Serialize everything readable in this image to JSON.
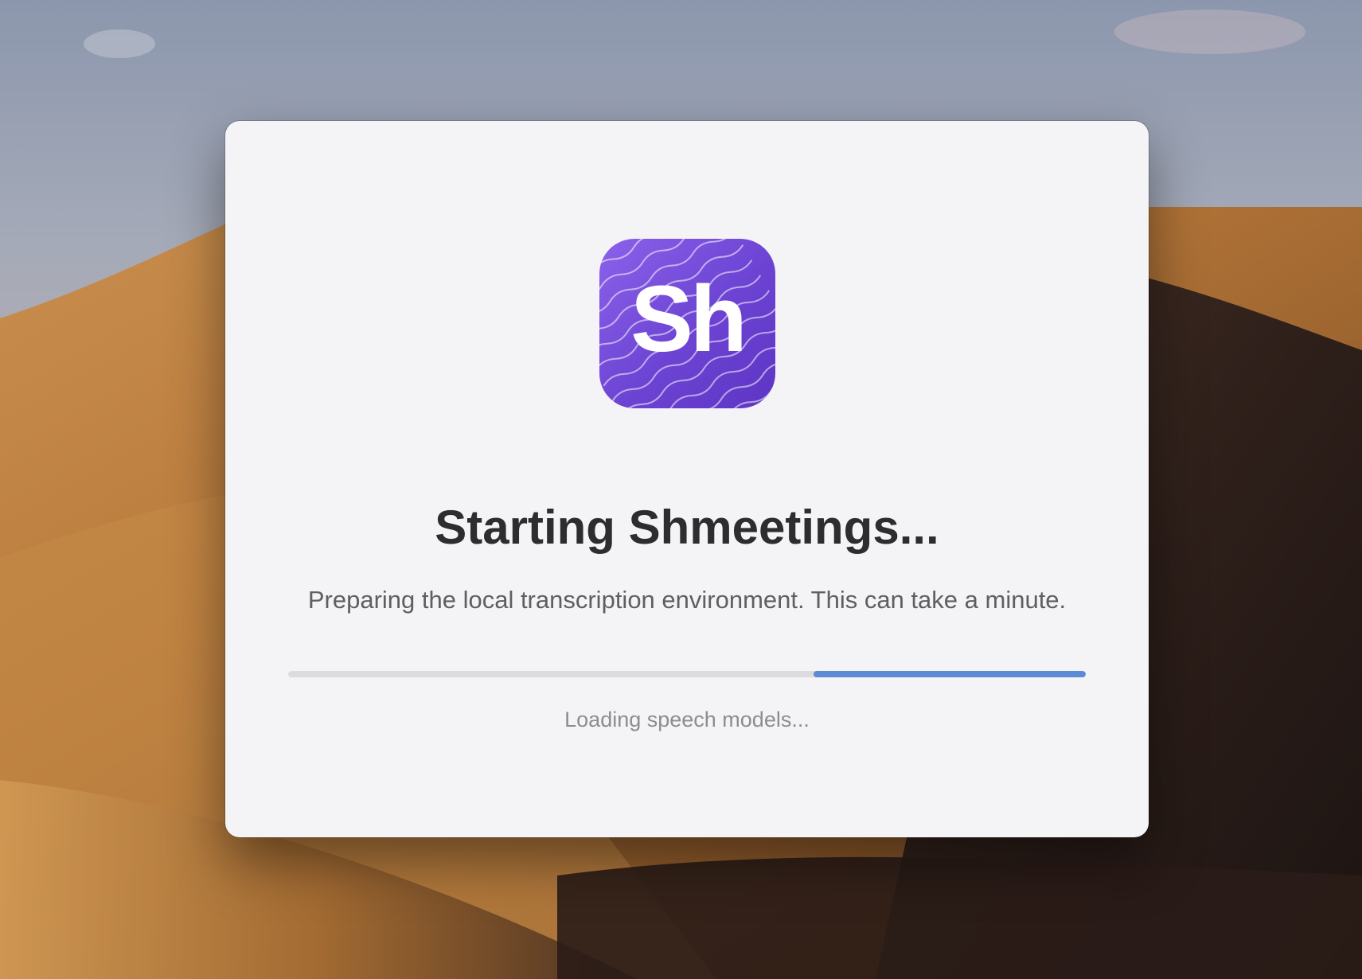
{
  "app": {
    "name": "Shmeetings",
    "icon_name": "shmeetings-app-icon",
    "monogram": "Sh",
    "accent_color": "#6c43d3"
  },
  "splash": {
    "title": "Starting Shmeetings...",
    "subtitle": "Preparing the local transcription environment. This can take a minute.",
    "status": "Loading speech models...",
    "progress_indeterminate": true,
    "progress_fill_color": "#5b8bd6"
  },
  "desktop": {
    "wallpaper": "desert-dunes"
  }
}
